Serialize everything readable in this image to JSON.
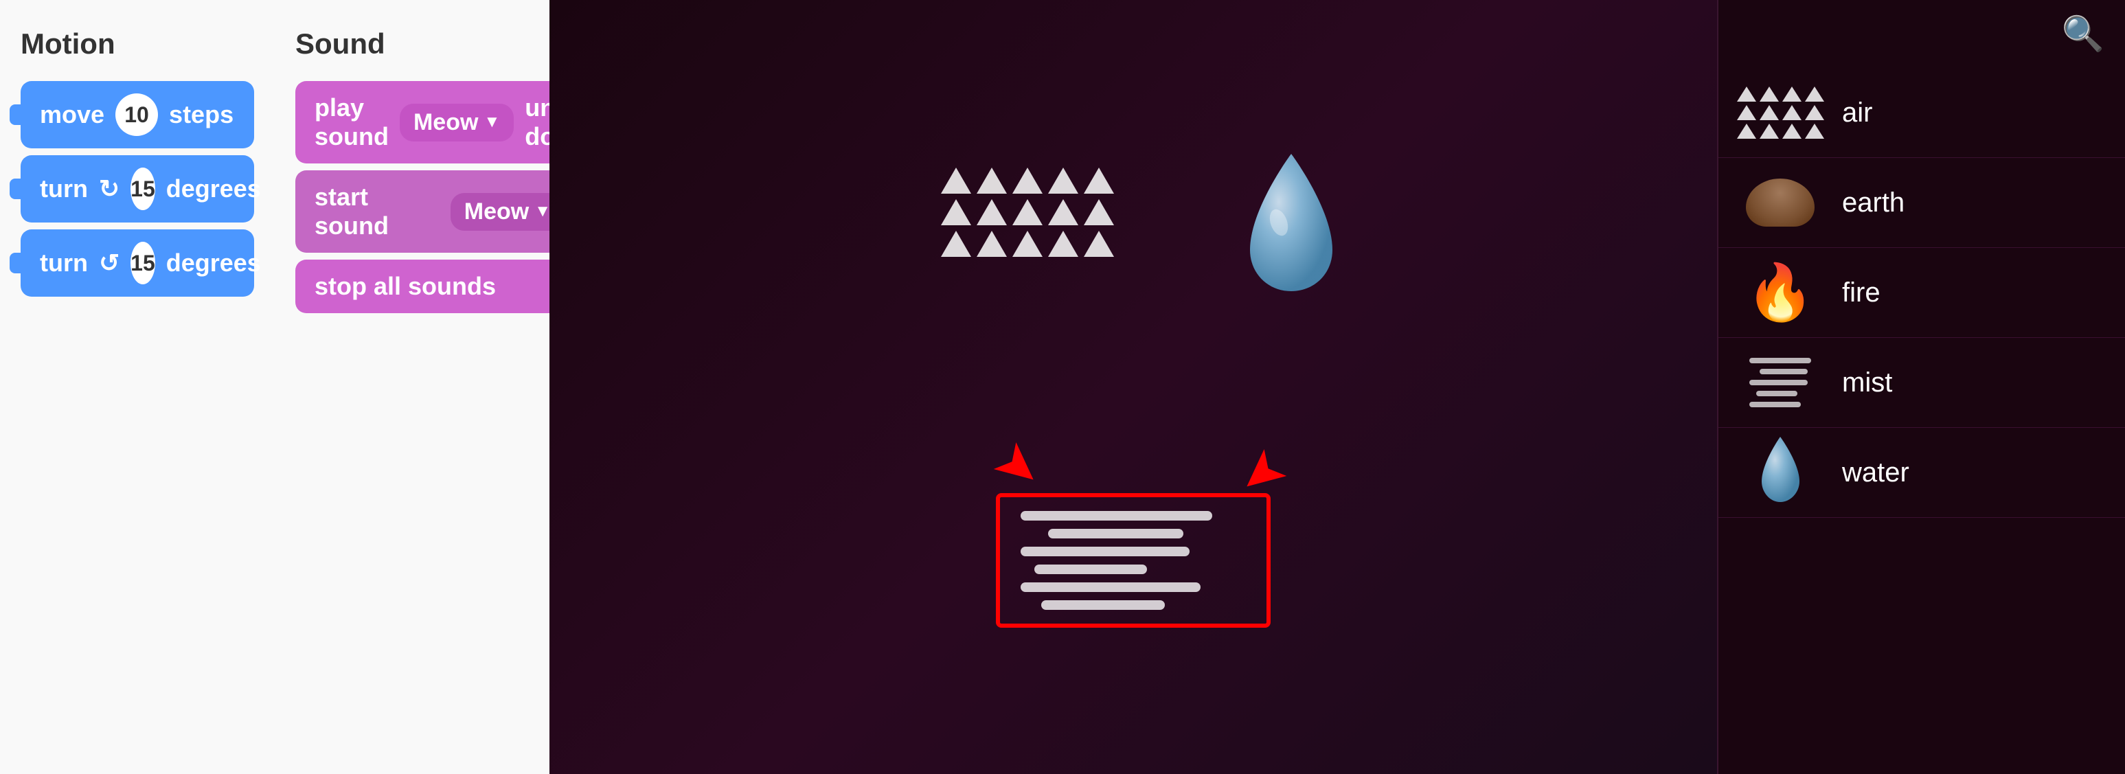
{
  "motion": {
    "title": "Motion",
    "blocks": [
      {
        "type": "move",
        "label_pre": "move",
        "value": "10",
        "label_post": "steps"
      },
      {
        "type": "turn_cw",
        "label_pre": "turn",
        "icon": "↻",
        "value": "15",
        "label_post": "degrees"
      },
      {
        "type": "turn_ccw",
        "label_pre": "turn",
        "icon": "↺",
        "value": "15",
        "label_post": "degrees"
      }
    ]
  },
  "sound": {
    "title": "Sound",
    "blocks": [
      {
        "type": "play_sound",
        "label_pre": "play sound",
        "dropdown": "Meow",
        "label_post": "until done"
      },
      {
        "type": "start_sound",
        "label_pre": "start sound",
        "dropdown": "Meow"
      },
      {
        "type": "stop_sounds",
        "label": "stop all sounds"
      }
    ]
  },
  "elements": {
    "search_tooltip": "Search",
    "items": [
      {
        "name": "air",
        "icon": "air-triangles"
      },
      {
        "name": "earth",
        "icon": "earth-shape"
      },
      {
        "name": "fire",
        "icon": "fire-emoji"
      },
      {
        "name": "mist",
        "icon": "mist-lines"
      },
      {
        "name": "water",
        "icon": "water-drop"
      }
    ]
  },
  "scene": {
    "air_label": "air",
    "water_label": "water",
    "mist_label": "mist"
  }
}
